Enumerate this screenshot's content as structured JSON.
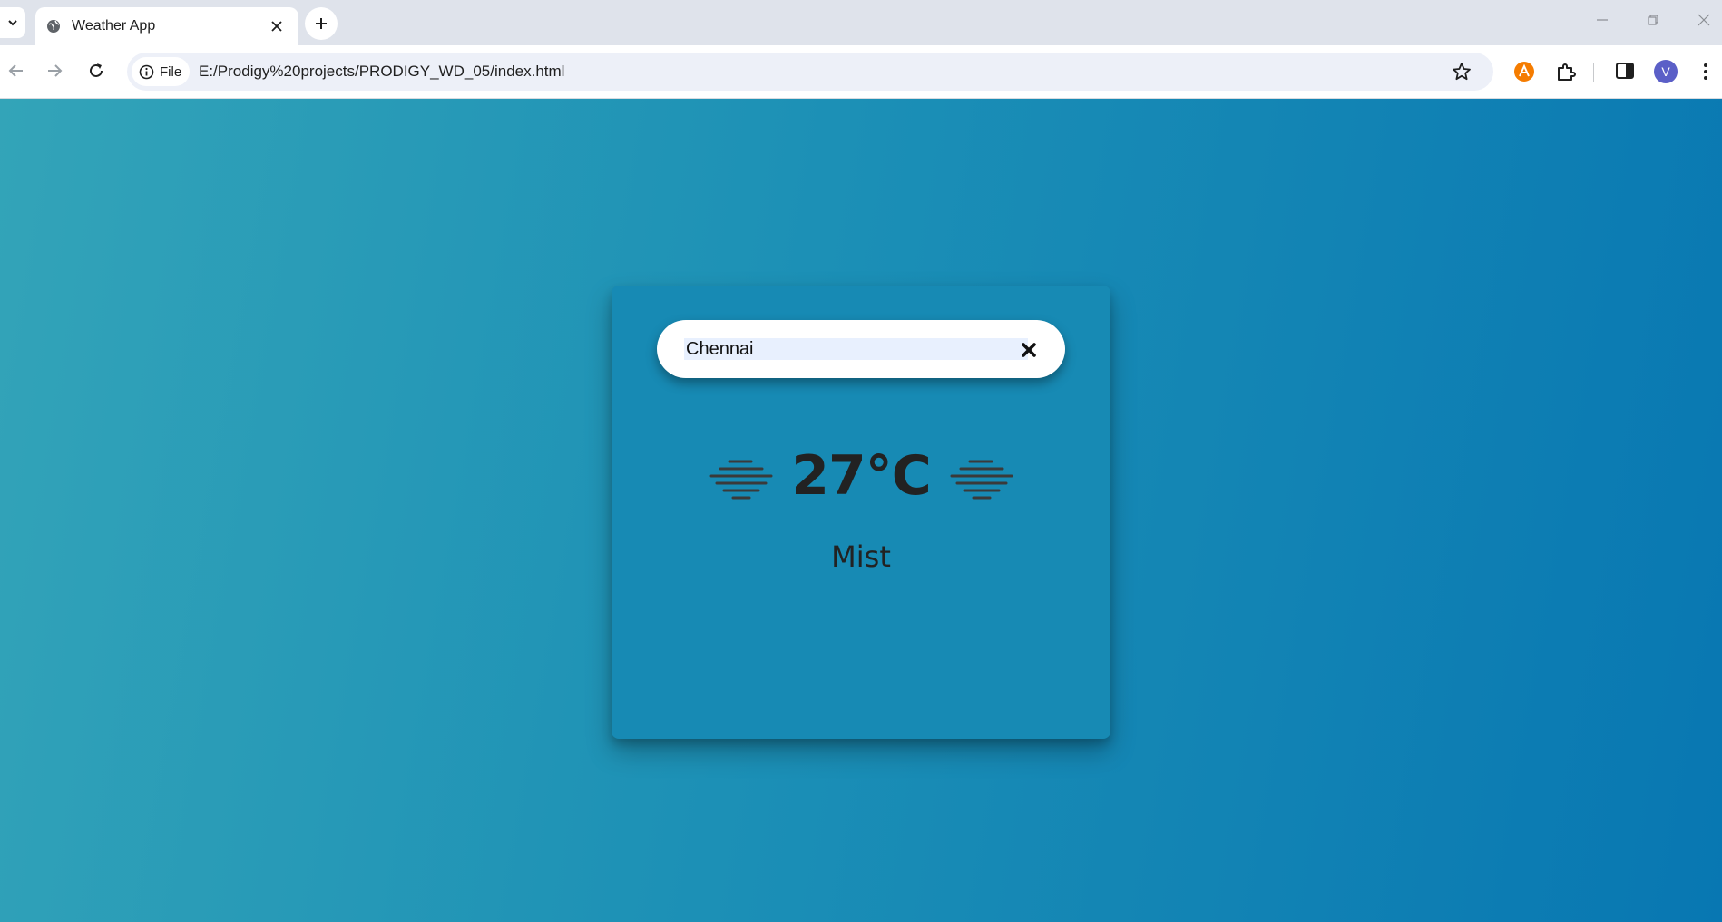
{
  "browser": {
    "tab": {
      "title": "Weather App"
    },
    "omnibox": {
      "chip_label": "File",
      "url": "E:/Prodigy%20projects/PRODIGY_WD_05/index.html"
    },
    "profile_initial": "V"
  },
  "weather": {
    "search": {
      "value": "Chennai"
    },
    "temperature": "27°C",
    "condition": "Mist",
    "icon": "mist-icon"
  },
  "colors": {
    "gradient_start": "#33a4b8",
    "gradient_end": "#0877b2",
    "card": "#178ab4",
    "text": "#222222"
  }
}
